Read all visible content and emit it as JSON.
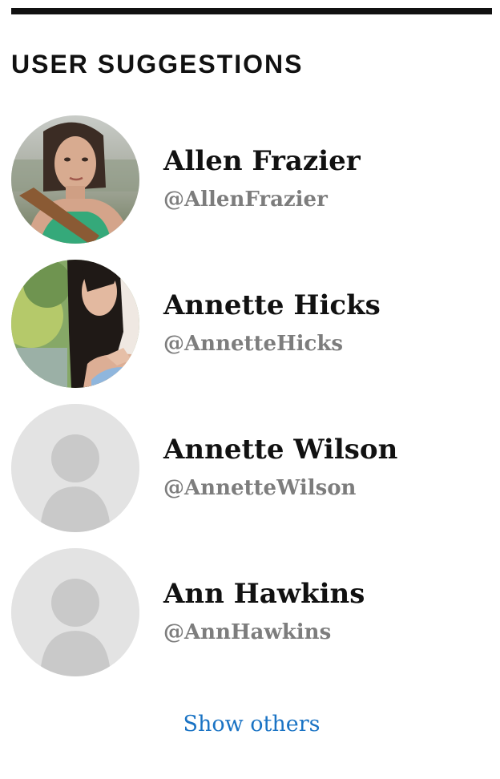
{
  "widget": {
    "title": "USER SUGGESTIONS",
    "show_others_label": "Show others"
  },
  "users": [
    {
      "name": "Allen Frazier",
      "handle": "@AllenFrazier",
      "avatar": "photo-woman-outdoors"
    },
    {
      "name": "Annette Hicks",
      "handle": "@AnnetteHicks",
      "avatar": "photo-woman-garden"
    },
    {
      "name": "Annette Wilson",
      "handle": "@AnnetteWilson",
      "avatar": "default-avatar-icon"
    },
    {
      "name": "Ann Hawkins",
      "handle": "@AnnHawkins",
      "avatar": "default-avatar-icon"
    }
  ],
  "colors": {
    "rule": "#111111",
    "name": "#111111",
    "handle": "#7d7d7d",
    "link": "#1a73c4",
    "placeholder_bg": "#e3e3e3",
    "placeholder_fg": "#c9c9c9"
  }
}
